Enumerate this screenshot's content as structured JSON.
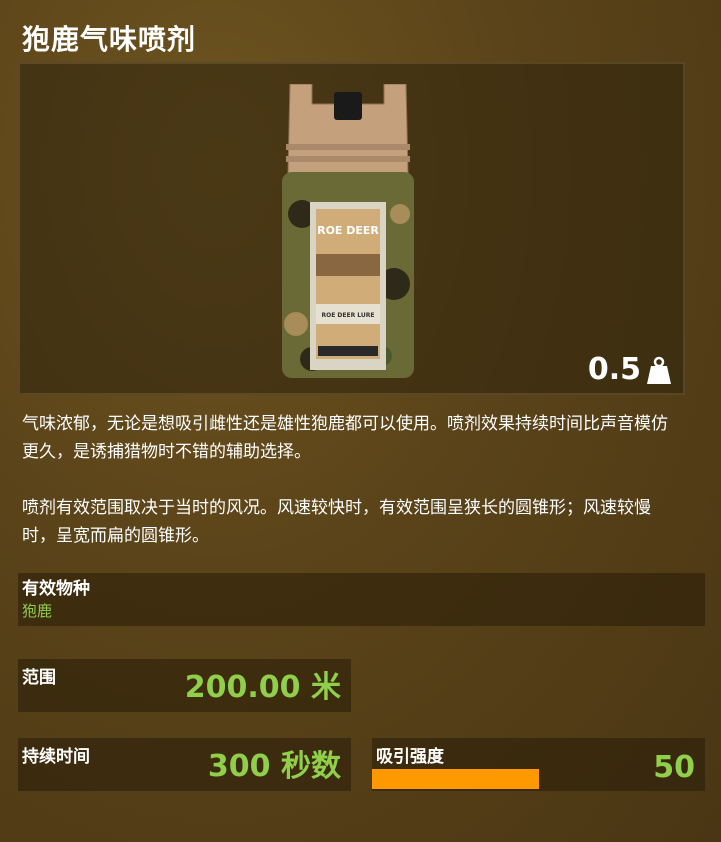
{
  "item": {
    "title": "狍鹿气味喷剂",
    "weight": "0.5",
    "bottle_label_brand": "ROE DEER",
    "bottle_label_sub": "ROE DEER LURE"
  },
  "description": {
    "para1": "气味浓郁，无论是想吸引雌性还是雄性狍鹿都可以使用。喷剂效果持续时间比声音模仿更久，是诱捕猎物时不错的辅助选择。",
    "para2": "喷剂有效范围取决于当时的风况。风速较快时，有效范围呈狭长的圆锥形；风速较慢时，呈宽而扁的圆锥形。"
  },
  "species": {
    "label": "有效物种",
    "value": "狍鹿"
  },
  "stats": {
    "range_label": "范围",
    "range_value": "200.00 米",
    "duration_label": "持续时间",
    "duration_value": "300 秒数",
    "attract_label": "吸引强度",
    "attract_value": "50",
    "attract_fraction": 0.5
  },
  "colors": {
    "accent_green": "#8fcf4a",
    "bar_orange": "#ff9900"
  }
}
